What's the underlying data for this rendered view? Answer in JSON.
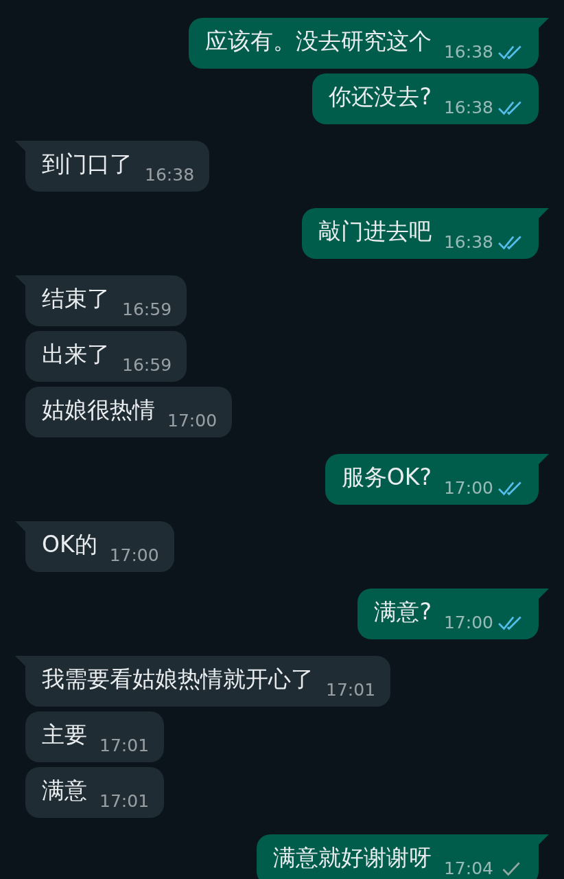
{
  "messages": [
    {
      "kind": "outgoing",
      "text": "应该有。没去研究这个",
      "time": "16:38",
      "read": true
    },
    {
      "kind": "outgoing",
      "text": "你还没去?",
      "time": "16:38",
      "read": true
    },
    {
      "kind": "incoming",
      "text": "到门口了",
      "time": "16:38"
    },
    {
      "kind": "outgoing",
      "text": "敲门进去吧",
      "time": "16:38",
      "read": true
    },
    {
      "kind": "incoming",
      "text": "结束了",
      "time": "16:59"
    },
    {
      "kind": "incoming",
      "text": "出来了",
      "time": "16:59"
    },
    {
      "kind": "incoming",
      "text": "姑娘很热情",
      "time": "17:00"
    },
    {
      "kind": "outgoing",
      "text": "服务OK?",
      "time": "17:00",
      "read": true
    },
    {
      "kind": "incoming",
      "text": "OK的",
      "time": "17:00"
    },
    {
      "kind": "outgoing",
      "text": "满意?",
      "time": "17:00",
      "read": true
    },
    {
      "kind": "incoming",
      "text": "我需要看姑娘热情就开心了",
      "time": "17:01"
    },
    {
      "kind": "incoming",
      "text": "主要",
      "time": "17:01"
    },
    {
      "kind": "incoming",
      "text": "满意",
      "time": "17:01"
    },
    {
      "kind": "outgoing",
      "text": "满意就好谢谢呀",
      "time": "17:04",
      "read": false
    }
  ]
}
